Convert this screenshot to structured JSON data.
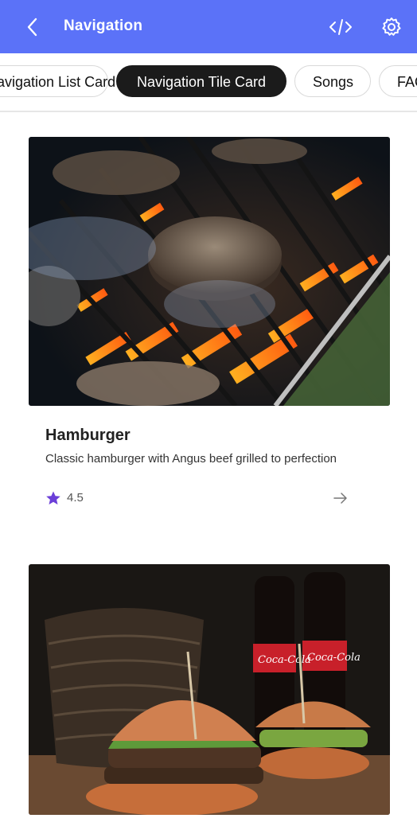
{
  "appbar": {
    "title": "Navigation",
    "back_icon": "chevron-left-icon",
    "code_icon": "code-icon",
    "settings_icon": "gear-icon",
    "color": "#5b72f8"
  },
  "tabs": [
    {
      "label": "Navigation List Card",
      "active": false
    },
    {
      "label": "Navigation Tile Card",
      "active": true
    },
    {
      "label": "Songs",
      "active": false
    },
    {
      "label": "FAQ",
      "active": false
    }
  ],
  "cards": [
    {
      "title": "Hamburger",
      "description": "Classic hamburger with Angus beef grilled to perfection",
      "rating": "4.5",
      "rating_icon": "star-icon",
      "rating_color": "#6b3fd8",
      "action_icon": "arrow-right-icon"
    },
    {
      "bottle_label": "Coca-Cola"
    }
  ]
}
